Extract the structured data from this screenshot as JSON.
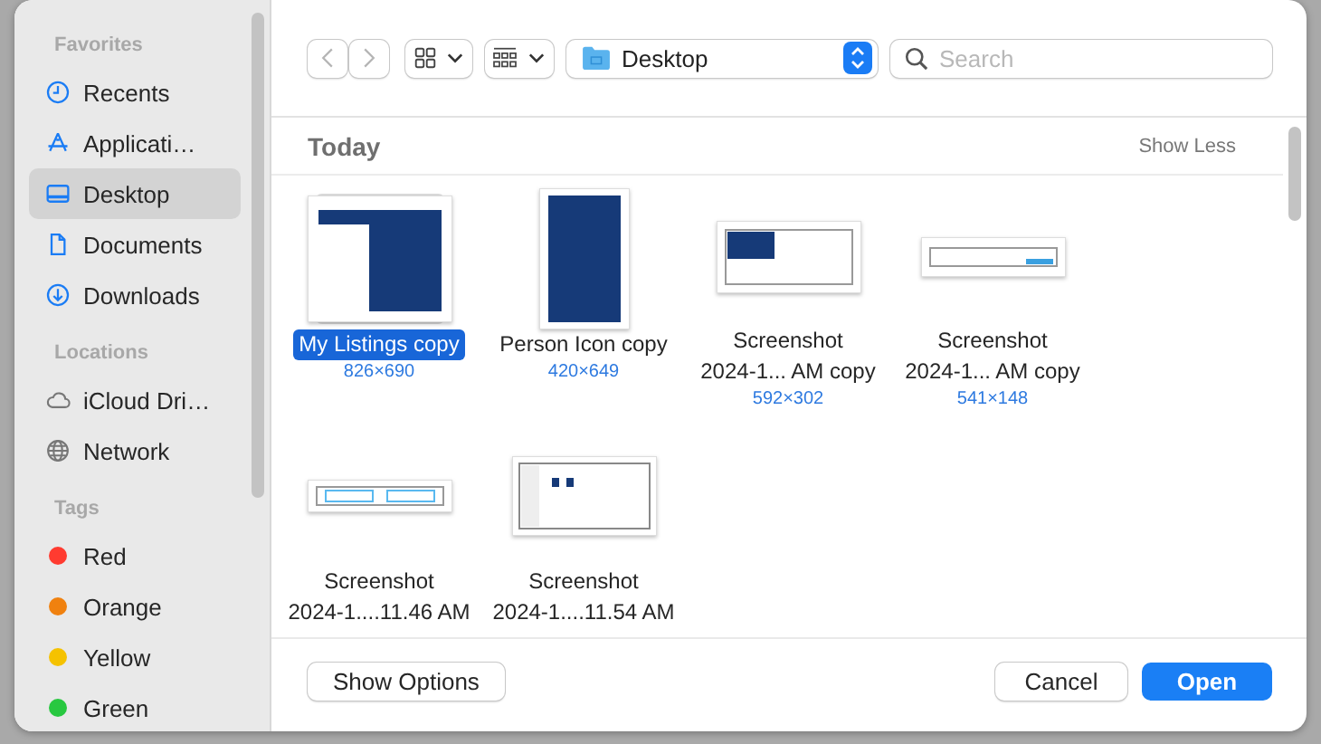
{
  "sidebar": {
    "sections": [
      {
        "title": "Favorites",
        "items": [
          {
            "label": "Recents",
            "selected": false
          },
          {
            "label": "Applicati…",
            "selected": false
          },
          {
            "label": "Desktop",
            "selected": true
          },
          {
            "label": "Documents",
            "selected": false
          },
          {
            "label": "Downloads",
            "selected": false
          }
        ]
      },
      {
        "title": "Locations",
        "items": [
          {
            "label": "iCloud Dri…",
            "selected": false
          },
          {
            "label": "Network",
            "selected": false
          }
        ]
      },
      {
        "title": "Tags",
        "items": [
          {
            "label": "Red",
            "color": "#ff3b30"
          },
          {
            "label": "Orange",
            "color": "#f0810f"
          },
          {
            "label": "Yellow",
            "color": "#f5c200"
          },
          {
            "label": "Green",
            "color": "#28c840"
          }
        ]
      }
    ]
  },
  "toolbar": {
    "location": "Desktop",
    "search": {
      "placeholder": "Search"
    }
  },
  "section": {
    "title": "Today",
    "action": "Show Less"
  },
  "files": [
    {
      "name": "My Listings copy",
      "dims": "826×690",
      "selected": true
    },
    {
      "name": "Person Icon copy",
      "dims": "420×649",
      "selected": false
    },
    {
      "name": "Screenshot\n2024-1... AM copy",
      "dims": "592×302",
      "selected": false
    },
    {
      "name": "Screenshot\n2024-1... AM copy",
      "dims": "541×148",
      "selected": false
    },
    {
      "name": "Screenshot\n2024-1....11.46 AM",
      "selected": false
    },
    {
      "name": "Screenshot\n2024-1....11.54 AM",
      "selected": false
    }
  ],
  "buttons": {
    "options": "Show Options",
    "cancel": "Cancel",
    "open": "Open"
  }
}
